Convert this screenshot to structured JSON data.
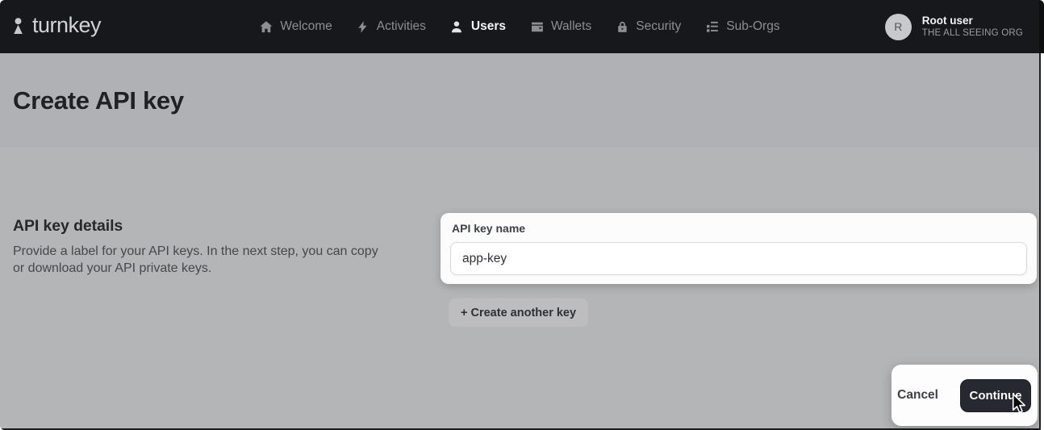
{
  "navbar": {
    "brand": "turnkey",
    "items": [
      {
        "label": "Welcome",
        "icon": "home-icon"
      },
      {
        "label": "Activities",
        "icon": "bolt-icon"
      },
      {
        "label": "Users",
        "icon": "person-icon",
        "active": true
      },
      {
        "label": "Wallets",
        "icon": "wallet-icon"
      },
      {
        "label": "Security",
        "icon": "lock-icon"
      },
      {
        "label": "Sub-Orgs",
        "icon": "org-list-icon"
      }
    ],
    "user": {
      "initial": "R",
      "name": "Root user",
      "org": "THE ALL SEEING ORG"
    }
  },
  "page": {
    "title": "Create API key"
  },
  "section": {
    "heading": "API key details",
    "description": "Provide a label for your API keys. In the next step, you can copy or download your API private keys."
  },
  "form": {
    "api_key_name_label": "API key name",
    "api_key_name_value": "app-key",
    "create_another_label": "+ Create another key"
  },
  "footer": {
    "cancel_label": "Cancel",
    "continue_label": "Continue"
  },
  "colors": {
    "navbar_bg": "#17181c",
    "page_header_bg": "#b0b1b5",
    "page_body_bg": "#b4b5b6",
    "dark_button_bg": "#26292f",
    "card_bg": "#fcfcfd"
  }
}
